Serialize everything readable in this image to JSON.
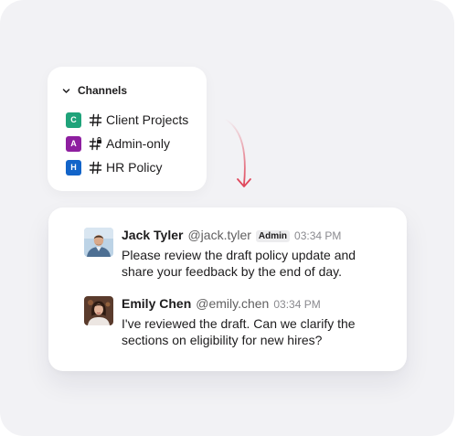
{
  "sidebar": {
    "section_title": "Channels",
    "channels": [
      {
        "badge": "C",
        "label": "Client Projects",
        "badge_color": "#1fa37a",
        "locked": false
      },
      {
        "badge": "A",
        "label": "Admin-only",
        "badge_color": "#8e1fa0",
        "locked": true
      },
      {
        "badge": "H",
        "label": "HR Policy",
        "badge_color": "#1264c9",
        "locked": false
      }
    ]
  },
  "arrow": {
    "color": "#e0485c"
  },
  "messages": [
    {
      "name": "Jack Tyler",
      "handle": "@jack.tyler",
      "badge": "Admin",
      "time": "03:34 PM",
      "text": "Please review the draft policy update and share your feedback by the end of day.",
      "avatar": "jack-avatar"
    },
    {
      "name": "Emily Chen",
      "handle": "@emily.chen",
      "time": "03:34 PM",
      "text": "I've reviewed the draft. Can we clarify the sections on eligibility for new hires?",
      "avatar": "emily-avatar"
    }
  ]
}
